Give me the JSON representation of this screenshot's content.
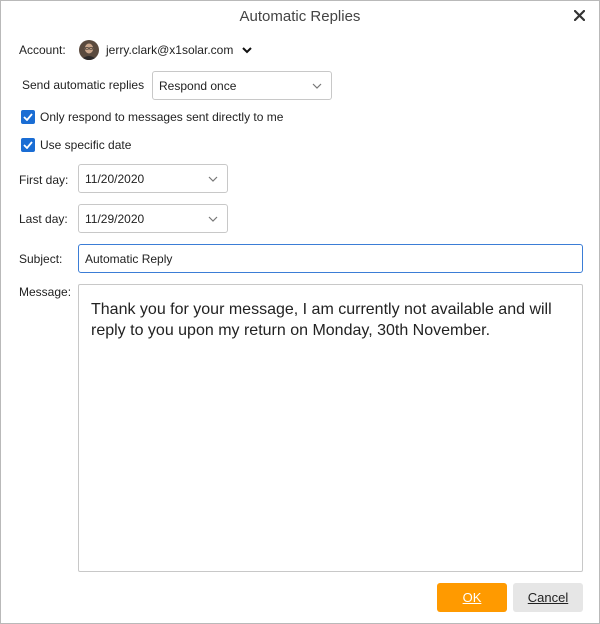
{
  "window": {
    "title": "Automatic Replies"
  },
  "account": {
    "label": "Account:",
    "email": "jerry.clark@x1solar.com"
  },
  "send": {
    "label": "Send automatic replies",
    "value": "Respond once"
  },
  "options": {
    "only_direct": {
      "label": "Only respond to messages sent directly to me",
      "checked": true
    },
    "specific_date": {
      "label": "Use specific date",
      "checked": true
    }
  },
  "first_day": {
    "label": "First day:",
    "value": "11/20/2020"
  },
  "last_day": {
    "label": "Last day:",
    "value": "11/29/2020"
  },
  "subject": {
    "label": "Subject:",
    "value": "Automatic Reply"
  },
  "message": {
    "label": "Message:",
    "value": "Thank you for your message, I am currently not available and will reply to you upon my return on Monday, 30th November."
  },
  "buttons": {
    "ok": "OK",
    "cancel": "Cancel"
  },
  "colors": {
    "accent": "#ff9a00",
    "checkbox": "#1a6dd4",
    "focus_border": "#3b7dd6"
  },
  "icons": {
    "close": "close-icon",
    "account_menu": "chevron-down-icon",
    "dropdown": "chevron-down-icon",
    "avatar": "user-avatar"
  }
}
